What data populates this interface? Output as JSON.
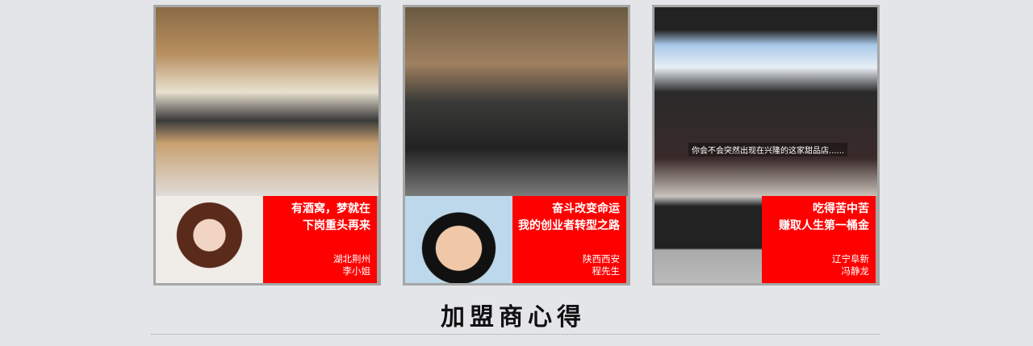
{
  "cards": [
    {
      "headline_1": "有酒窝，梦就在",
      "headline_2": "下岗重头再来",
      "location": "湖北荆州",
      "name": "李小姐"
    },
    {
      "headline_1": "奋斗改变命运",
      "headline_2": "我的创业者转型之路",
      "location": "陕西西安",
      "name": "程先生"
    },
    {
      "headline_1": "吃得苦中苦",
      "headline_2": "赚取人生第一桶金",
      "location": "辽宁阜新",
      "name": "冯静龙",
      "photo_caption": "你会不会突然出现在兴隆的这家甜品店......"
    }
  ],
  "section_title": "加盟商心得",
  "colors": {
    "accent": "#fe0000",
    "background": "#e4e5e8"
  }
}
